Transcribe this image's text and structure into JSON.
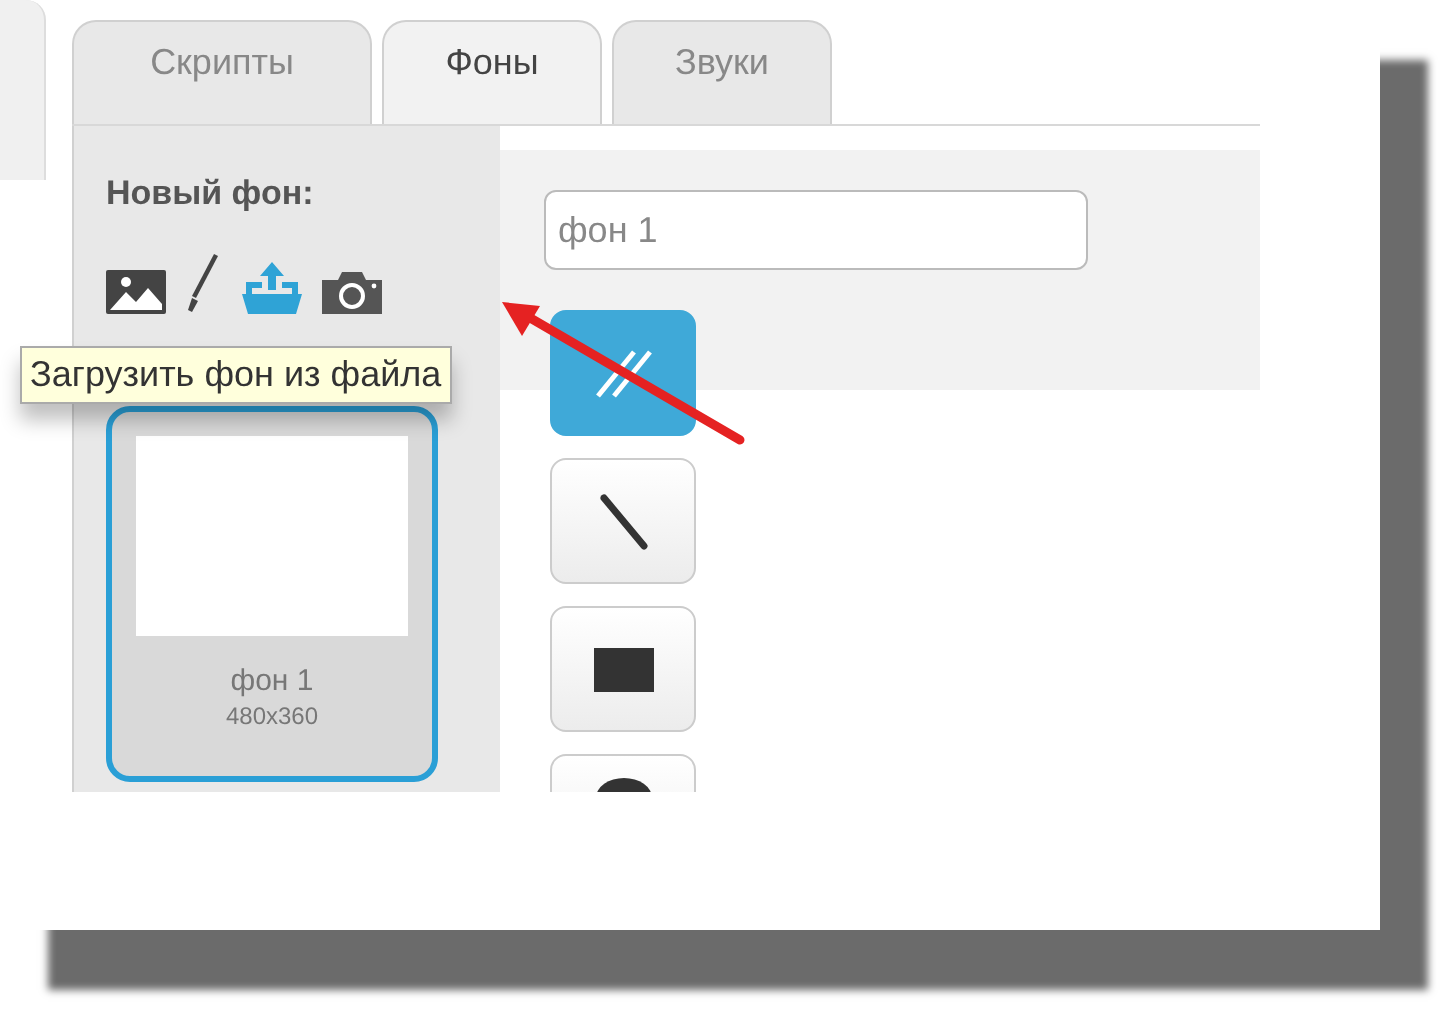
{
  "tabs": [
    {
      "label": "Скрипты",
      "selected": false
    },
    {
      "label": "Фоны",
      "selected": true
    },
    {
      "label": "Звуки",
      "selected": false
    }
  ],
  "new_backdrop": {
    "label": "Новый фон:",
    "buttons": [
      {
        "kind": "library",
        "highlighted": false
      },
      {
        "kind": "paint",
        "highlighted": false
      },
      {
        "kind": "upload",
        "highlighted": true
      },
      {
        "kind": "camera",
        "highlighted": false
      }
    ]
  },
  "tooltip": "Загрузить фон из файла",
  "backdrops": [
    {
      "name": "фон 1",
      "size": "480x360",
      "selected": true
    }
  ],
  "name_field": {
    "value": "фон 1"
  },
  "tools": [
    {
      "kind": "reshape",
      "selected": true
    },
    {
      "kind": "line",
      "selected": false
    },
    {
      "kind": "rectangle",
      "selected": false
    },
    {
      "kind": "ellipse",
      "selected": false
    }
  ]
}
